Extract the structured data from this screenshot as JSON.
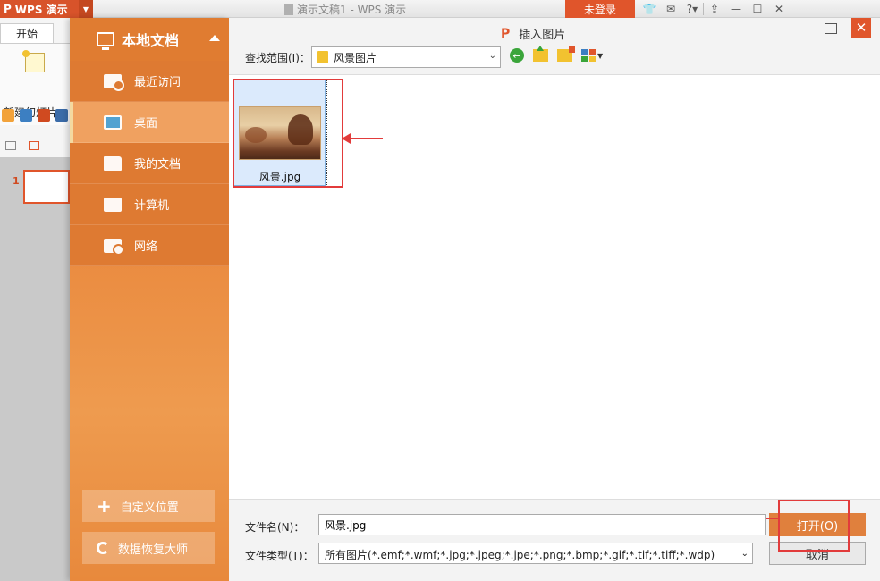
{
  "app": {
    "logo_label": "WPS 演示",
    "doc_title": "演示文稿1 - WPS 演示",
    "login_label": "未登录",
    "toolbar_icons": [
      "shirt-icon",
      "chat-icon",
      "help-icon",
      "upload-icon",
      "minimize-icon",
      "maximize-icon",
      "close-icon"
    ]
  },
  "ribbon": {
    "tab_start": "开始",
    "new_slide_label": "新建幻灯片",
    "slide_number": "1"
  },
  "sidebar": {
    "header": "本地文档",
    "items": [
      {
        "label": "最近访问",
        "icon": "recent-icon"
      },
      {
        "label": "桌面",
        "icon": "desktop-icon",
        "active": true
      },
      {
        "label": "我的文档",
        "icon": "folder-icon"
      },
      {
        "label": "计算机",
        "icon": "computer-icon"
      },
      {
        "label": "网络",
        "icon": "network-icon"
      }
    ],
    "custom_location": "自定义位置",
    "data_recovery": "数据恢复大师"
  },
  "dialog": {
    "title": "插入图片",
    "lookin_label": "查找范围(I)：",
    "lookin_value": "风景图片",
    "files": [
      {
        "name": "风景.jpg",
        "type": "image"
      }
    ],
    "filename_label": "文件名(N)：",
    "filename_value": "风景.jpg",
    "filetype_label": "文件类型(T)：",
    "filetype_value": "所有图片(*.emf;*.wmf;*.jpg;*.jpeg;*.jpe;*.png;*.bmp;*.gif;*.tif;*.tiff;*.wdp)",
    "open_button": "打开(O)",
    "cancel_button": "取消"
  },
  "colors": {
    "accent": "#e0552b",
    "sidebar": "#e98a3e"
  }
}
